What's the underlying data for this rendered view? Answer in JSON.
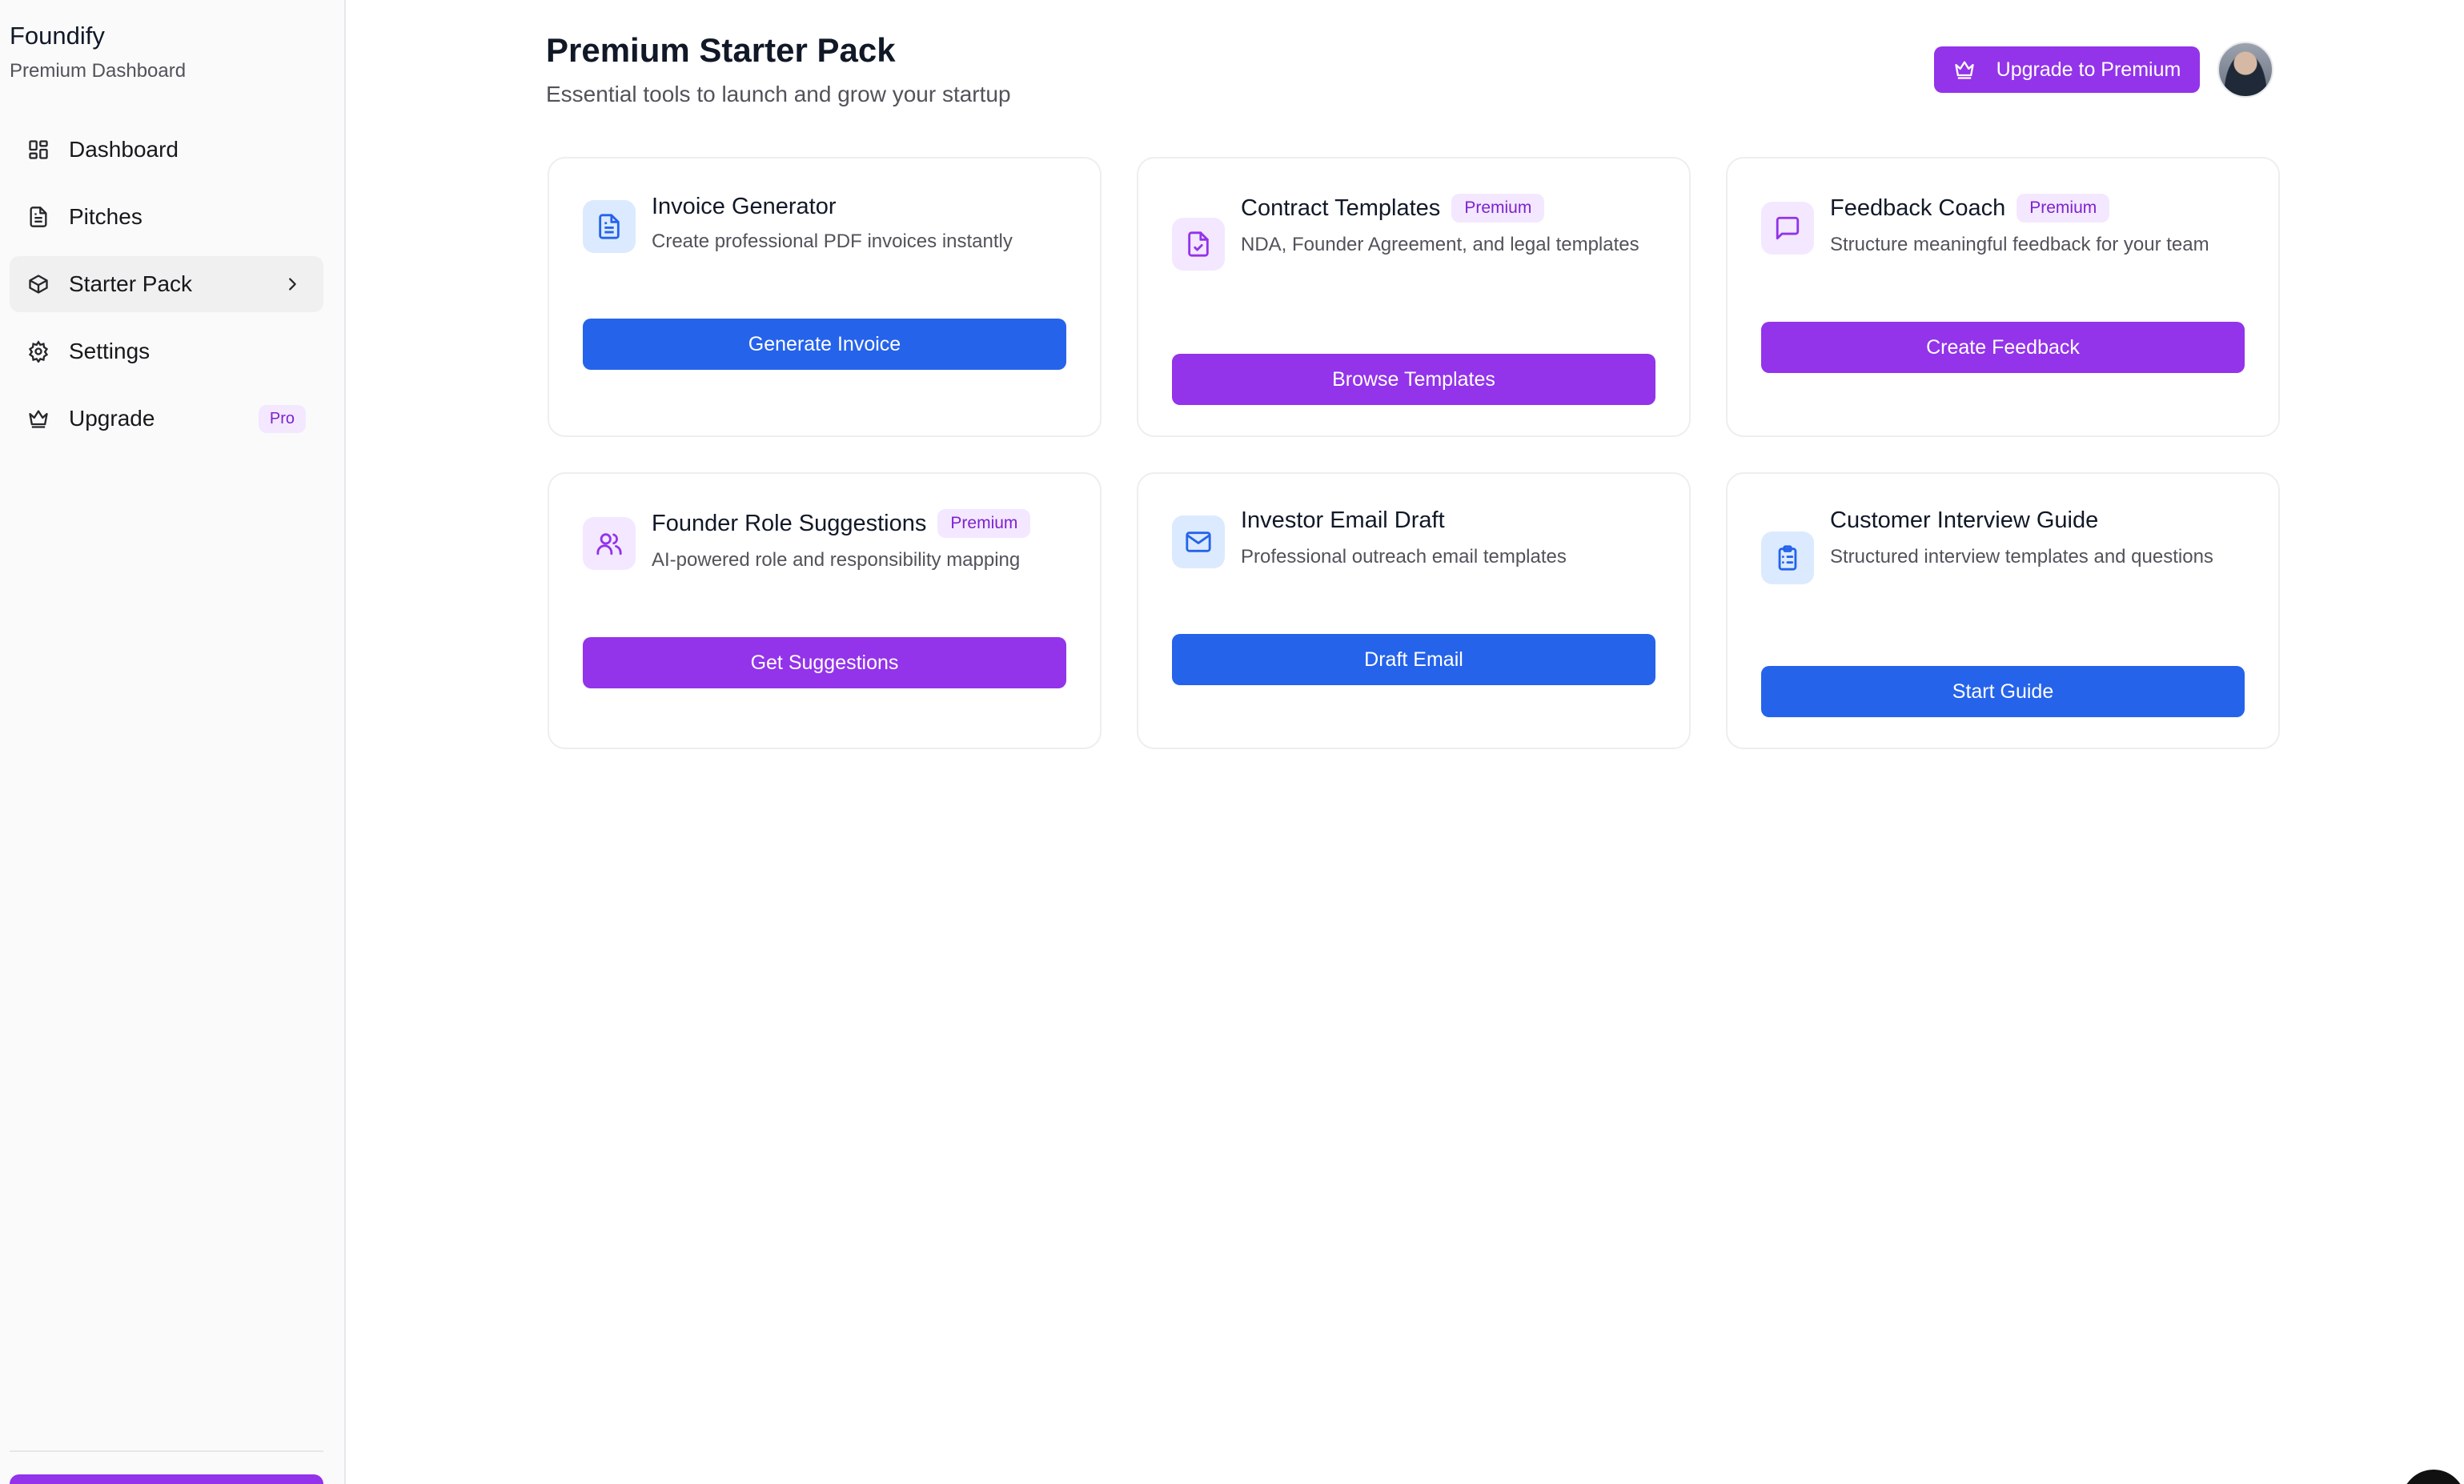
{
  "sidebar": {
    "brand_name": "Foundify",
    "brand_sub": "Premium Dashboard",
    "items": [
      {
        "label": "Dashboard",
        "icon": "grid-icon"
      },
      {
        "label": "Pitches",
        "icon": "document-icon"
      },
      {
        "label": "Starter Pack",
        "icon": "package-icon",
        "active": true
      },
      {
        "label": "Settings",
        "icon": "gear-icon"
      },
      {
        "label": "Upgrade",
        "icon": "crown-icon",
        "badge": "Pro"
      }
    ]
  },
  "header": {
    "title": "Premium Starter Pack",
    "subtitle": "Essential tools to launch and grow your startup",
    "upgrade_label": "Upgrade to Premium"
  },
  "cards": [
    {
      "title": "Invoice Generator",
      "premium": false,
      "description": "Create professional PDF invoices instantly",
      "button": "Generate Invoice",
      "accent": "blue",
      "icon": "file-text-icon"
    },
    {
      "title": "Contract Templates",
      "premium": true,
      "premium_label": "Premium",
      "description": "NDA, Founder Agreement, and legal templates",
      "button": "Browse Templates",
      "accent": "purple",
      "icon": "file-check-icon"
    },
    {
      "title": "Feedback Coach",
      "premium": true,
      "premium_label": "Premium",
      "description": "Structure meaningful feedback for your team",
      "button": "Create Feedback",
      "accent": "purple",
      "icon": "message-square-icon"
    },
    {
      "title": "Founder Role Suggestions",
      "premium": true,
      "premium_label": "Premium",
      "description": "AI-powered role and responsibility mapping",
      "button": "Get Suggestions",
      "accent": "purple",
      "icon": "users-icon"
    },
    {
      "title": "Investor Email Draft",
      "premium": false,
      "description": "Professional outreach email templates",
      "button": "Draft Email",
      "accent": "blue",
      "icon": "mail-icon"
    },
    {
      "title": "Customer Interview Guide",
      "premium": false,
      "description": "Structured interview templates and questions",
      "button": "Start Guide",
      "accent": "blue",
      "icon": "clipboard-list-icon"
    }
  ],
  "colors": {
    "blue": "#2563eb",
    "purple": "#9333ea",
    "blue_tint": "#dbeafe",
    "purple_tint": "#f3e8ff"
  }
}
